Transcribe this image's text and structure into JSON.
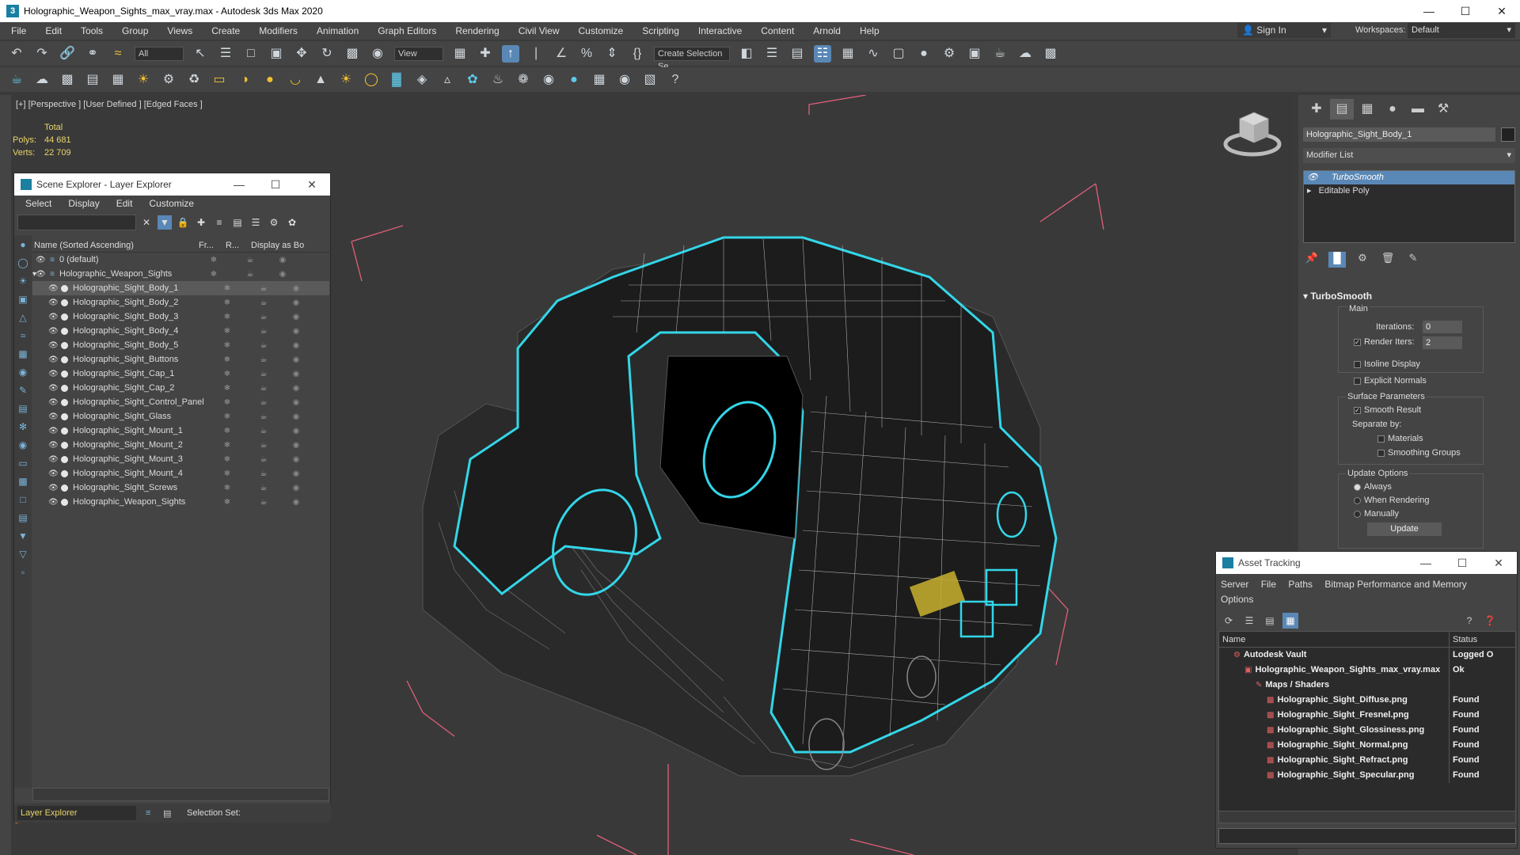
{
  "window": {
    "title": "Holographic_Weapon_Sights_max_vray.max - Autodesk 3ds Max 2020",
    "app_icon": "3"
  },
  "menu": [
    "File",
    "Edit",
    "Tools",
    "Group",
    "Views",
    "Create",
    "Modifiers",
    "Animation",
    "Graph Editors",
    "Rendering",
    "Civil View",
    "Customize",
    "Scripting",
    "Interactive",
    "Content",
    "Arnold",
    "Help"
  ],
  "account": {
    "sign_in": "Sign In",
    "workspaces_label": "Workspaces:",
    "workspace_value": "Default"
  },
  "toolbar": {
    "filter_all": "All",
    "ref_coord": "View",
    "selection_set": "Create Selection Se"
  },
  "viewport": {
    "label": "[+] [Perspective ] [User Defined ] [Edged Faces ]",
    "stats_total": "Total",
    "polys_label": "Polys:",
    "polys_value": "44 681",
    "verts_label": "Verts:",
    "verts_value": "22 709"
  },
  "scene_explorer": {
    "title": "Scene Explorer - Layer Explorer",
    "menu": [
      "Select",
      "Display",
      "Edit",
      "Customize"
    ],
    "columns": {
      "name": "Name (Sorted Ascending)",
      "frozen": "Fr...",
      "render": "R...",
      "display": "Display as Bo"
    },
    "rows": [
      {
        "name": "0 (default)",
        "indent": 1,
        "selected": false
      },
      {
        "name": "Holographic_Weapon_Sights",
        "indent": 1,
        "selected": false
      },
      {
        "name": "Holographic_Sight_Body_1",
        "indent": 2,
        "selected": true
      },
      {
        "name": "Holographic_Sight_Body_2",
        "indent": 2,
        "selected": false
      },
      {
        "name": "Holographic_Sight_Body_3",
        "indent": 2,
        "selected": false
      },
      {
        "name": "Holographic_Sight_Body_4",
        "indent": 2,
        "selected": false
      },
      {
        "name": "Holographic_Sight_Body_5",
        "indent": 2,
        "selected": false
      },
      {
        "name": "Holographic_Sight_Buttons",
        "indent": 2,
        "selected": false
      },
      {
        "name": "Holographic_Sight_Cap_1",
        "indent": 2,
        "selected": false
      },
      {
        "name": "Holographic_Sight_Cap_2",
        "indent": 2,
        "selected": false
      },
      {
        "name": "Holographic_Sight_Control_Panel",
        "indent": 2,
        "selected": false
      },
      {
        "name": "Holographic_Sight_Glass",
        "indent": 2,
        "selected": false
      },
      {
        "name": "Holographic_Sight_Mount_1",
        "indent": 2,
        "selected": false
      },
      {
        "name": "Holographic_Sight_Mount_2",
        "indent": 2,
        "selected": false
      },
      {
        "name": "Holographic_Sight_Mount_3",
        "indent": 2,
        "selected": false
      },
      {
        "name": "Holographic_Sight_Mount_4",
        "indent": 2,
        "selected": false
      },
      {
        "name": "Holographic_Sight_Screws",
        "indent": 2,
        "selected": false
      },
      {
        "name": "Holographic_Weapon_Sights",
        "indent": 2,
        "selected": false
      }
    ],
    "footer_mode": "Layer Explorer",
    "selection_set_label": "Selection Set:"
  },
  "command_panel": {
    "object_name": "Holographic_Sight_Body_1",
    "modifier_list": "Modifier List",
    "stack": [
      {
        "name": "TurboSmooth",
        "selected": true
      },
      {
        "name": "Editable Poly",
        "selected": false
      }
    ],
    "rollout_title": "TurboSmooth",
    "main_label": "Main",
    "iterations_label": "Iterations:",
    "iterations_value": "0",
    "render_iters_label": "Render Iters:",
    "render_iters_value": "2",
    "isoline_display": "Isoline Display",
    "explicit_normals": "Explicit Normals",
    "surface_params_label": "Surface Parameters",
    "smooth_result": "Smooth Result",
    "separate_by": "Separate by:",
    "materials": "Materials",
    "smoothing_groups": "Smoothing Groups",
    "update_options": "Update Options",
    "always": "Always",
    "when_rendering": "When Rendering",
    "manually": "Manually",
    "update_button": "Update"
  },
  "asset_tracking": {
    "title": "Asset Tracking",
    "menu": [
      "Server",
      "File",
      "Paths",
      "Bitmap Performance and Memory",
      "Options"
    ],
    "col_name": "Name",
    "col_status": "Status",
    "rows": [
      {
        "name": "Autodesk Vault",
        "status": "Logged O",
        "indent": 1
      },
      {
        "name": "Holographic_Weapon_Sights_max_vray.max",
        "status": "Ok",
        "indent": 2
      },
      {
        "name": "Maps / Shaders",
        "status": "",
        "indent": 3
      },
      {
        "name": "Holographic_Sight_Diffuse.png",
        "status": "Found",
        "indent": 4
      },
      {
        "name": "Holographic_Sight_Fresnel.png",
        "status": "Found",
        "indent": 4
      },
      {
        "name": "Holographic_Sight_Glossiness.png",
        "status": "Found",
        "indent": 4
      },
      {
        "name": "Holographic_Sight_Normal.png",
        "status": "Found",
        "indent": 4
      },
      {
        "name": "Holographic_Sight_Refract.png",
        "status": "Found",
        "indent": 4
      },
      {
        "name": "Holographic_Sight_Specular.png",
        "status": "Found",
        "indent": 4
      }
    ]
  },
  "colors": {
    "accent": "#5a88b6",
    "selection_outline": "#33d6e8",
    "bbox": "#e0607a",
    "stats": "#e8d56a"
  }
}
